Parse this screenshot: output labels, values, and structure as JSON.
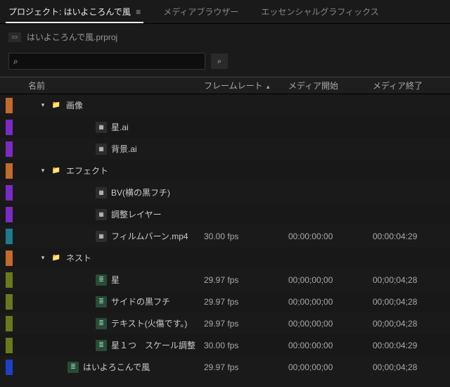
{
  "tabs": {
    "project": "プロジェクト: はいよころんで風",
    "media_browser": "メディアブラウザー",
    "essential_gfx": "エッセンシャルグラフィックス"
  },
  "project_file": "はいよころんで風.prproj",
  "search": {
    "placeholder": ""
  },
  "columns": {
    "name": "名前",
    "framerate": "フレームレート",
    "media_start": "メディア開始",
    "media_end": "メディア終了"
  },
  "rows": [
    {
      "swatch": "#c46a2b",
      "indent": 1,
      "caret": true,
      "icon": "folder",
      "label": "画像",
      "fr": "",
      "start": "",
      "end": ""
    },
    {
      "swatch": "#7a2bc4",
      "indent": 3,
      "caret": false,
      "icon": "file",
      "label": "星.ai",
      "fr": "",
      "start": "",
      "end": ""
    },
    {
      "swatch": "#7a2bc4",
      "indent": 3,
      "caret": false,
      "icon": "file",
      "label": "背景.ai",
      "fr": "",
      "start": "",
      "end": ""
    },
    {
      "swatch": "#c46a2b",
      "indent": 1,
      "caret": true,
      "icon": "folder",
      "label": "エフェクト",
      "fr": "",
      "start": "",
      "end": ""
    },
    {
      "swatch": "#7a2bc4",
      "indent": 3,
      "caret": false,
      "icon": "file",
      "label": "BV(横の黒フチ)",
      "fr": "",
      "start": "",
      "end": ""
    },
    {
      "swatch": "#7a2bc4",
      "indent": 3,
      "caret": false,
      "icon": "file",
      "label": "調整レイヤー",
      "fr": "",
      "start": "",
      "end": ""
    },
    {
      "swatch": "#1f7a8c",
      "indent": 3,
      "caret": false,
      "icon": "file",
      "label": "フィルムバーン.mp4",
      "fr": "30.00 fps",
      "start": "00:00:00:00",
      "end": "00:00:04:29"
    },
    {
      "swatch": "#c46a2b",
      "indent": 1,
      "caret": true,
      "icon": "folder",
      "label": "ネスト",
      "fr": "",
      "start": "",
      "end": ""
    },
    {
      "swatch": "#6a7a1a",
      "indent": 3,
      "caret": false,
      "icon": "seq",
      "label": "星",
      "fr": "29.97 fps",
      "start": "00;00;00;00",
      "end": "00;00;04;28"
    },
    {
      "swatch": "#6a7a1a",
      "indent": 3,
      "caret": false,
      "icon": "seq",
      "label": "サイドの黒フチ",
      "fr": "29.97 fps",
      "start": "00;00;00;00",
      "end": "00;00;04;28"
    },
    {
      "swatch": "#6a7a1a",
      "indent": 3,
      "caret": false,
      "icon": "seq",
      "label": "テキスト(火傷です。)",
      "fr": "29.97 fps",
      "start": "00;00;00;00",
      "end": "00;00;04;28"
    },
    {
      "swatch": "#6a7a1a",
      "indent": 3,
      "caret": false,
      "icon": "seq",
      "label": "星１つ　スケール調整",
      "fr": "30.00 fps",
      "start": "00:00:00:00",
      "end": "00:00:04:29"
    },
    {
      "swatch": "#1f3fc4",
      "indent": 2,
      "caret": false,
      "icon": "seq",
      "label": "はいよろこんで風",
      "fr": "29.97 fps",
      "start": "00;00;00;00",
      "end": "00;00;04;28"
    }
  ],
  "icons": {
    "folder": "📁",
    "file": "▦",
    "seq": "≣",
    "menu": "≡",
    "search": "⌕",
    "caret_down": "▾",
    "caret_up": "▴",
    "new_bin": "▢"
  }
}
